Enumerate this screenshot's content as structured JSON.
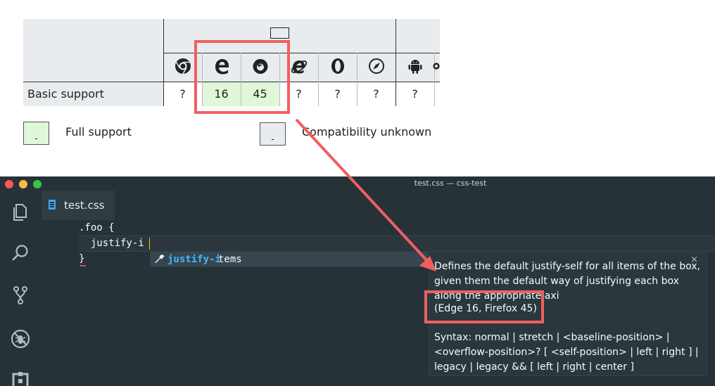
{
  "compat_table": {
    "row_label": "Basic support",
    "browsers": [
      {
        "icon": "chrome-icon",
        "value": "?",
        "supported": false
      },
      {
        "icon": "edge-icon",
        "value": "16",
        "supported": true
      },
      {
        "icon": "firefox-icon",
        "value": "45",
        "supported": true
      },
      {
        "icon": "ie-icon",
        "value": "?",
        "supported": false
      },
      {
        "icon": "opera-icon",
        "value": "?",
        "supported": false
      },
      {
        "icon": "safari-icon",
        "value": "?",
        "supported": false
      },
      {
        "icon": "android-icon",
        "value": "?",
        "supported": false
      }
    ],
    "desktop_icon": "desktop-icon",
    "green_color": "#e0f7d9"
  },
  "legend": {
    "full_support_mark": "-",
    "full_support_label": "Full support",
    "unknown_mark": "-",
    "unknown_label": "Compatibility unknown"
  },
  "annotation_color": "#f05f5f",
  "editor": {
    "window_title": "test.css — css-test",
    "tab_label": "test.css",
    "code": {
      "line1": ".foo {",
      "line2": "  justify-i",
      "line3": "}"
    },
    "suggestion": {
      "match": "justify-i",
      "rest": "tems",
      "icon": "wrench-icon"
    },
    "doc": {
      "close": "×",
      "description": "Defines the default justify-self for all items of the box, given them the default way of justifying each box along the appropriate axi",
      "compat": "(Edge 16, Firefox 45)",
      "syntax": "Syntax: normal | stretch | <baseline-position> | <overflow-position>? [ <self-position> | left | right ] | legacy | legacy && [ left | right | center ]"
    },
    "activity_icons": [
      "files-icon",
      "search-icon",
      "source-control-icon",
      "debug-icon",
      "extensions-icon"
    ]
  }
}
